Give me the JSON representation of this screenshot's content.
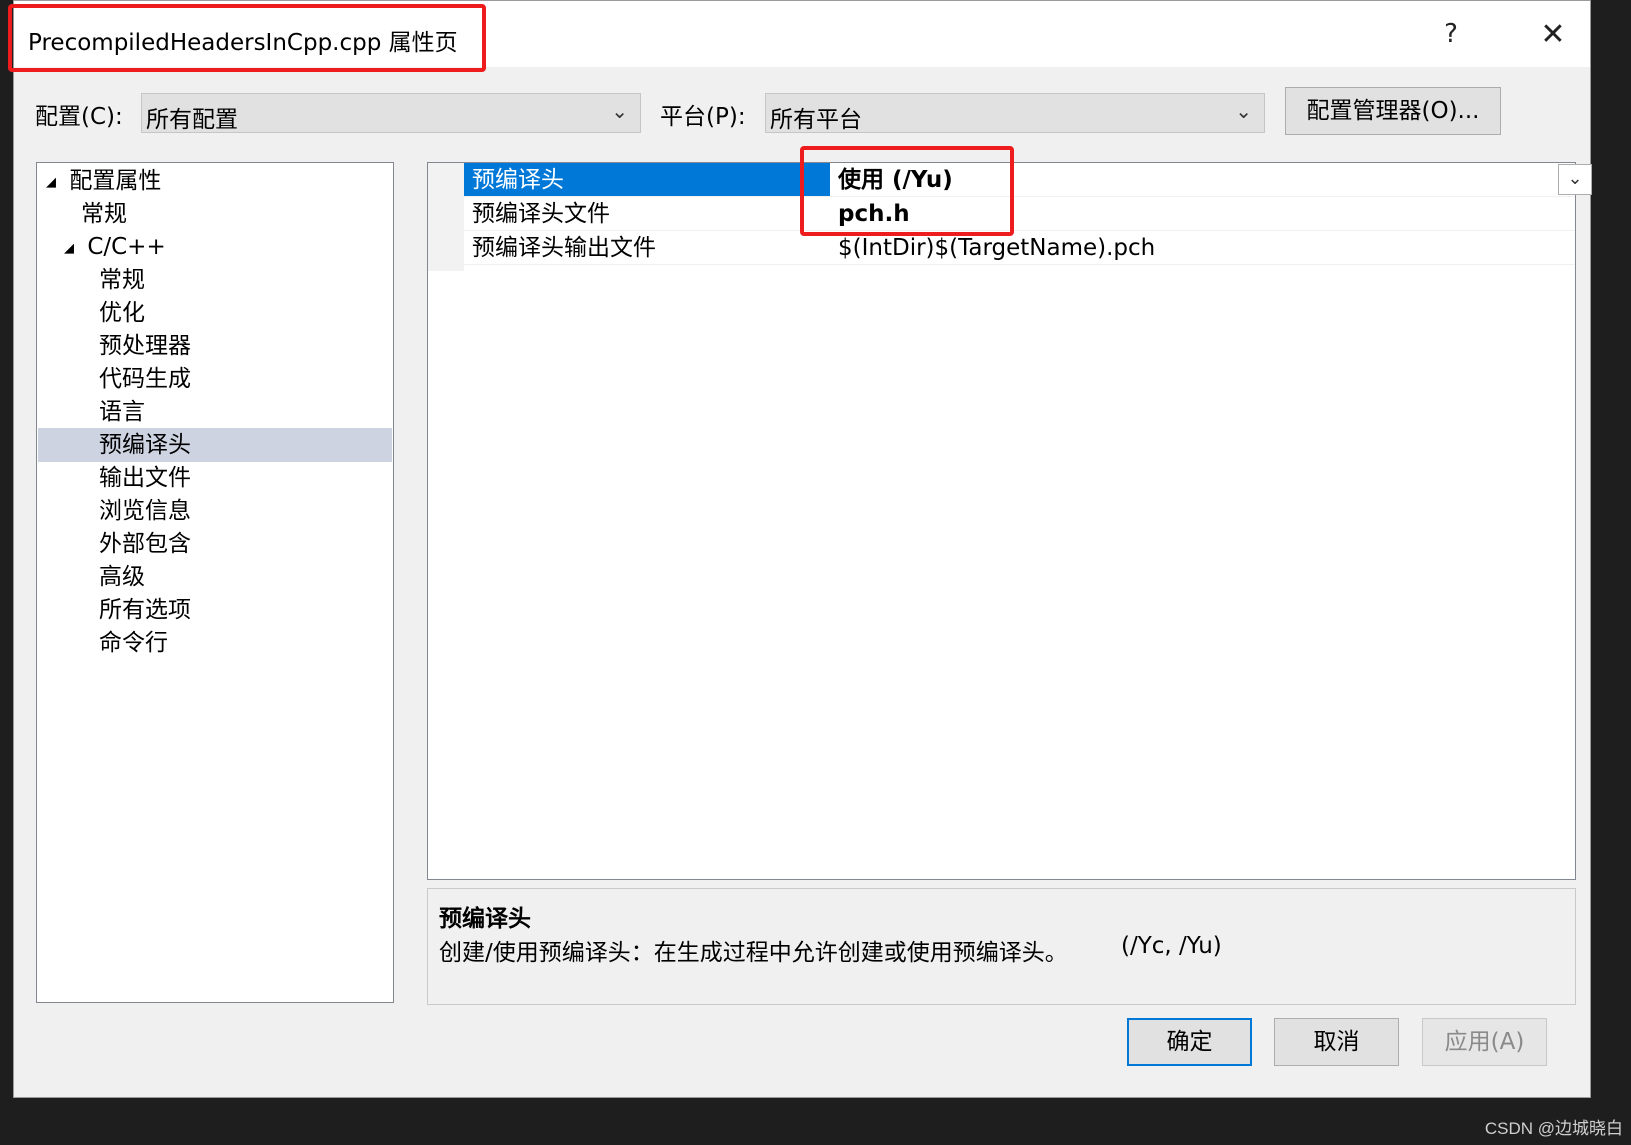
{
  "dialog": {
    "title": "PrecompiledHeadersInCpp.cpp 属性页",
    "help_glyph": "?",
    "close_glyph": "✕"
  },
  "config": {
    "label": "配置(C):",
    "value": "所有配置",
    "platform_label": "平台(P):",
    "platform_value": "所有平台",
    "manager_button": "配置管理器(O)..."
  },
  "tree": {
    "items": [
      {
        "label": "配置属性",
        "expanded": true
      },
      {
        "label": "常规"
      },
      {
        "label": "C/C++",
        "expanded": true
      },
      {
        "label": "常规"
      },
      {
        "label": "优化"
      },
      {
        "label": "预处理器"
      },
      {
        "label": "代码生成"
      },
      {
        "label": "语言"
      },
      {
        "label": "预编译头",
        "selected": true
      },
      {
        "label": "输出文件"
      },
      {
        "label": "浏览信息"
      },
      {
        "label": "外部包含"
      },
      {
        "label": "高级"
      },
      {
        "label": "所有选项"
      },
      {
        "label": "命令行"
      }
    ]
  },
  "properties": {
    "rows": [
      {
        "name": "预编译头",
        "value": "使用 (/Yu)"
      },
      {
        "name": "预编译头文件",
        "value": "pch.h"
      },
      {
        "name": "预编译头输出文件",
        "value": "$(IntDir)$(TargetName).pch"
      }
    ]
  },
  "description": {
    "title": "预编译头",
    "text": "创建/使用预编译头：在生成过程中允许创建或使用预编译头。",
    "flags": "(/Yc, /Yu)"
  },
  "buttons": {
    "ok": "确定",
    "cancel": "取消",
    "apply": "应用(A)"
  },
  "colors": {
    "selection_blue": "#0078d7",
    "annotation_red": "#ee1c1c",
    "tree_selection": "#cdd3e0"
  },
  "watermark": "CSDN @边城晓白"
}
